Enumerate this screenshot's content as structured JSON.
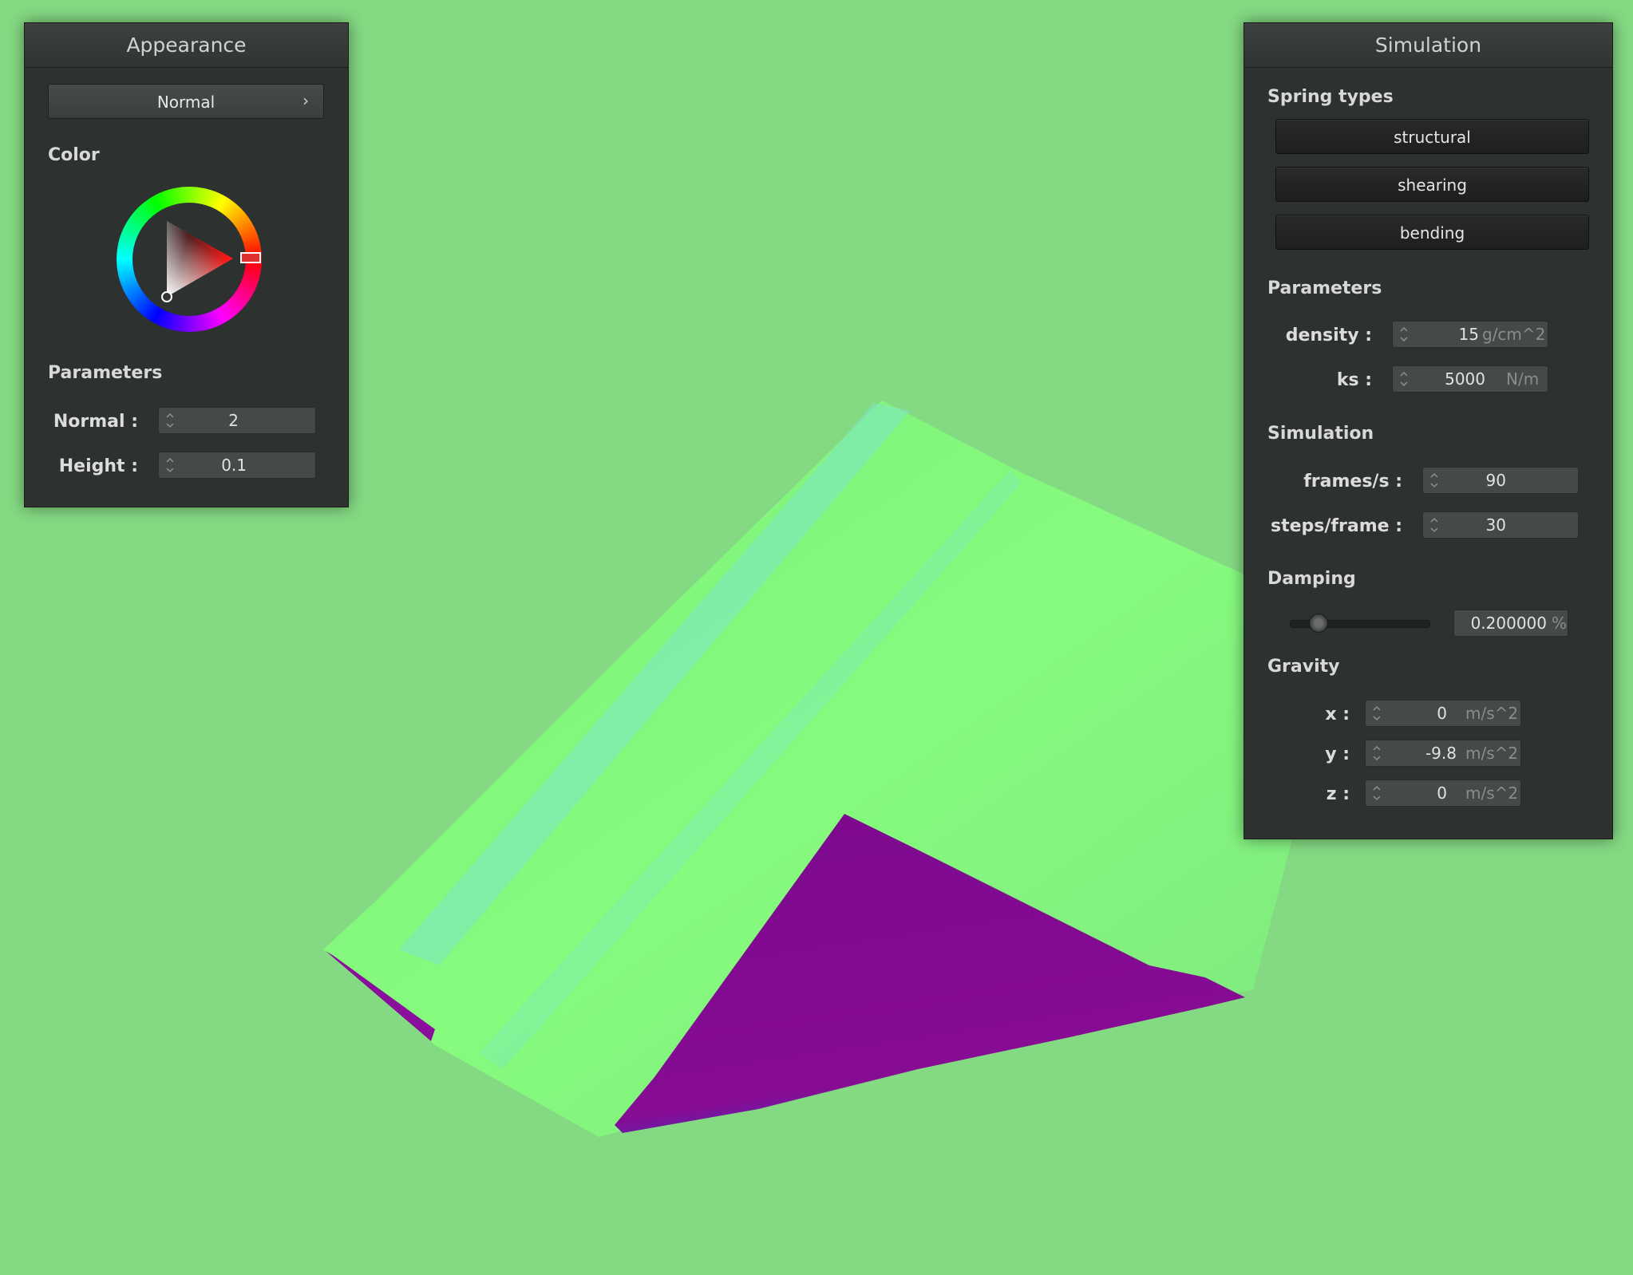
{
  "appearance": {
    "title": "Appearance",
    "shader_select": {
      "value": "Normal",
      "chevron": "›"
    },
    "color_label": "Color",
    "selected_color": "#e03030",
    "parameters_label": "Parameters",
    "normal": {
      "label": "Normal :",
      "value": "2"
    },
    "height": {
      "label": "Height :",
      "value": "0.1"
    }
  },
  "simulation": {
    "title": "Simulation",
    "spring_types_label": "Spring types",
    "spring_buttons": [
      "structural",
      "shearing",
      "bending"
    ],
    "parameters_label": "Parameters",
    "density": {
      "label": "density :",
      "value": "15",
      "unit": "g/cm^2"
    },
    "ks": {
      "label": "ks :",
      "value": "5000",
      "unit": "N/m"
    },
    "simulation_label": "Simulation",
    "frames": {
      "label": "frames/s :",
      "value": "90"
    },
    "steps": {
      "label": "steps/frame :",
      "value": "30"
    },
    "damping_label": "Damping",
    "damping": {
      "value": "0.200000",
      "unit": "%",
      "slider_fraction": 0.2
    },
    "gravity_label": "Gravity",
    "gx": {
      "label": "x :",
      "value": "0",
      "unit": "m/s^2"
    },
    "gy": {
      "label": "y :",
      "value": "-9.8",
      "unit": "m/s^2"
    },
    "gz": {
      "label": "z :",
      "value": "0",
      "unit": "m/s^2"
    }
  },
  "colors": {
    "background": "#84d983",
    "cloth_front": "#86fb7e",
    "cloth_back": "#7f0a90",
    "panel": "#2d3130"
  }
}
